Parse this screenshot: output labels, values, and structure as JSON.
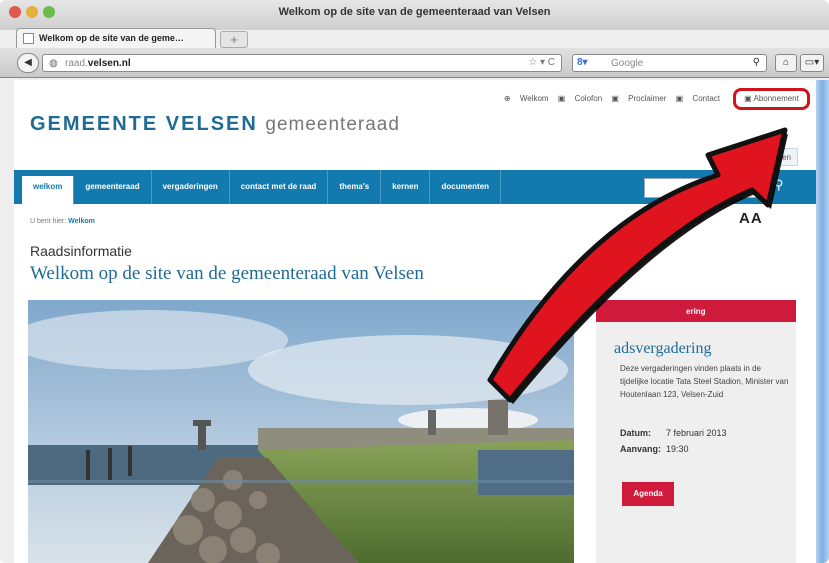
{
  "window": {
    "title": "Welkom op de site van de gemeenteraad van Velsen"
  },
  "tab": {
    "label": "Welkom op de site van de geme…",
    "new_tab": "+"
  },
  "toolbar": {
    "url_prefix": "raad.",
    "url_domain": "velsen.nl",
    "url_right": "☆ ▾ C",
    "search_engine": "8▾",
    "search_placeholder": "Google"
  },
  "site": {
    "top_links": [
      "Welkom",
      "Colofon",
      "Proclaimer",
      "Contact"
    ],
    "abonnement": "Abonnement",
    "logo_bold": "GEMEENTE VELSEN",
    "logo_thin": "gemeenteraad",
    "login": "Inloggen",
    "nav": [
      "welkom",
      "gemeenteraad",
      "vergaderingen",
      "contact met de raad",
      "thema's",
      "kernen",
      "documenten"
    ],
    "breadcrumb_prefix": "U bent hier:",
    "breadcrumb_current": "Welkom",
    "font_size_control": "AA",
    "subtitle": "Raadsinformatie",
    "title": "Welkom op de site van de gemeenteraad van Velsen"
  },
  "sidebar": {
    "header": "ering",
    "event_title": "adsvergadering",
    "description": "Deze vergaderingen vinden plaats in de tijdelijke locatie Tata Steel Stadion, Minister van Houtenlaan 123, Velsen-Zuid",
    "date_label": "Datum:",
    "date_value": "7 februari 2013",
    "start_label": "Aanvang:",
    "start_value": "19:30",
    "button": "Agenda"
  },
  "colors": {
    "brand_blue": "#137ab0",
    "accent_red": "#cf1a3b",
    "arrow_red": "#e0141e"
  }
}
